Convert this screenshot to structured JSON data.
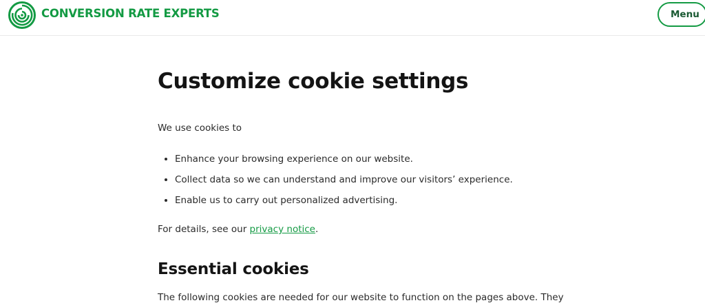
{
  "header": {
    "brand": "CONVERSION RATE EXPERTS",
    "menu_label": "Menu",
    "logo_icon": "maze-logo-icon",
    "brand_color": "#139a43"
  },
  "main": {
    "title": "Customize cookie settings",
    "intro": "We use cookies to",
    "bullets": [
      "Enhance your browsing experience on our website.",
      "Collect data so we can understand and improve our visitors’ experience.",
      "Enable us to carry out personalized advertising."
    ],
    "details_prefix": "For details, see our ",
    "details_link": "privacy notice",
    "details_suffix": ".",
    "section_title": "Essential cookies",
    "section_text_partial": "The following cookies are needed for our website to function on the pages above. They"
  }
}
